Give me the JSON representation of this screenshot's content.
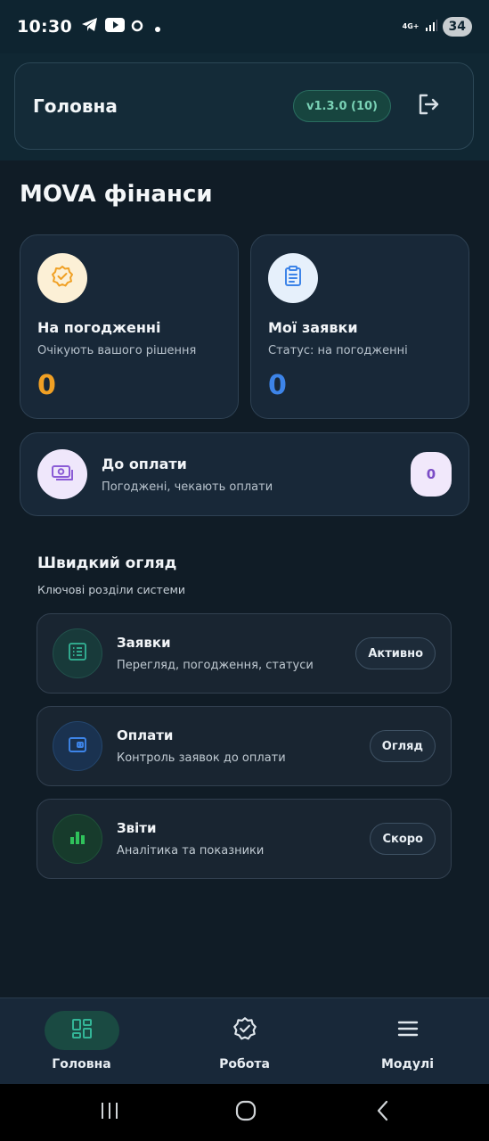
{
  "status_bar": {
    "time": "10:30",
    "network": "4G+",
    "battery": "34",
    "icons": [
      "telegram-icon",
      "youtube-icon",
      "circle-notification-icon",
      "dot-icon",
      "signal-icon"
    ]
  },
  "header": {
    "title": "Головна",
    "version": "v1.3.0 (10)",
    "logout_icon": "logout-icon"
  },
  "page": {
    "title": "MOVA фінанси"
  },
  "stats": [
    {
      "title": "На погодженні",
      "subtitle": "Очікують вашого рішення",
      "value": "0",
      "icon": "badge-check-icon",
      "color": "#f0a024",
      "icon_bg": "#fcf0d6"
    },
    {
      "title": "Мої заявки",
      "subtitle": "Статус: на погодженні",
      "value": "0",
      "icon": "clipboard-icon",
      "color": "#3d84e8",
      "icon_bg": "#e6f0fb"
    }
  ],
  "payment": {
    "title": "До оплати",
    "subtitle": "Погоджені, чекають оплати",
    "count": "0",
    "icon": "money-icon",
    "color": "#8b5cd6",
    "icon_bg": "#efe7fb"
  },
  "overview": {
    "title": "Швидкий огляд",
    "subtitle": "Ключові розділи системи",
    "items": [
      {
        "title": "Заявки",
        "subtitle": "Перегляд, погодження, статуси",
        "badge": "Активно",
        "icon": "list-icon",
        "color": "#33b597"
      },
      {
        "title": "Оплати",
        "subtitle": "Контроль заявок до оплати",
        "badge": "Огляд",
        "icon": "wallet-icon",
        "color": "#3d84e8"
      },
      {
        "title": "Звіти",
        "subtitle": "Аналітика та показники",
        "badge": "Скоро",
        "icon": "bar-chart-icon",
        "color": "#2fc25b"
      }
    ]
  },
  "bottom_nav": {
    "items": [
      {
        "label": "Головна",
        "icon": "dashboard-icon",
        "active": true
      },
      {
        "label": "Робота",
        "icon": "badge-check-icon",
        "active": false
      },
      {
        "label": "Модулі",
        "icon": "menu-icon",
        "active": false
      }
    ]
  },
  "system_nav": [
    "recent-apps-icon",
    "home-icon",
    "back-icon"
  ]
}
